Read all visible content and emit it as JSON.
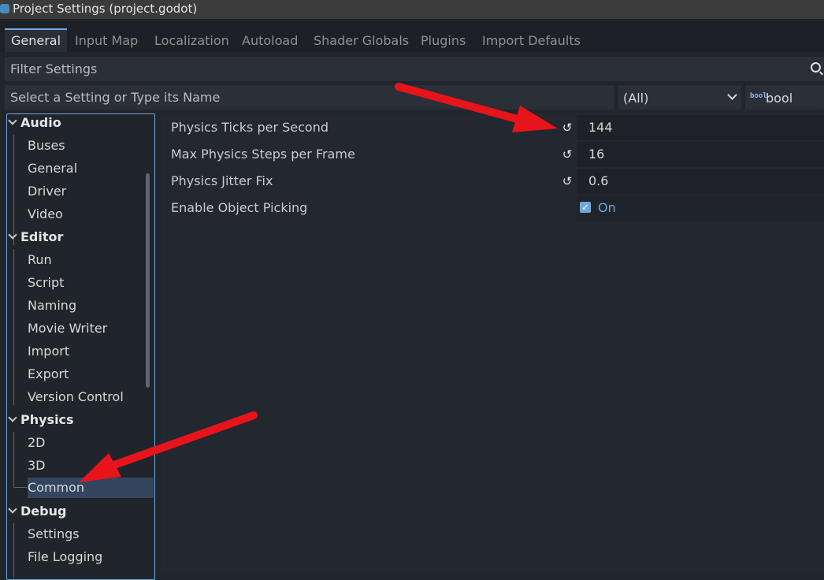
{
  "window": {
    "title": "Project Settings (project.godot)"
  },
  "tabs": [
    "General",
    "Input Map",
    "Localization",
    "Autoload",
    "Shader Globals",
    "Plugins",
    "Import Defaults"
  ],
  "filter": {
    "placeholder": "Filter Settings"
  },
  "add_setting": {
    "name_placeholder": "Select a Setting or Type its Name",
    "type_filter": "(All)",
    "type_icon": "bool",
    "type_value": "bool"
  },
  "tree": {
    "sections": [
      {
        "label": "Audio",
        "items": [
          "Buses",
          "General",
          "Driver",
          "Video"
        ]
      },
      {
        "label": "Editor",
        "items": [
          "Run",
          "Script",
          "Naming",
          "Movie Writer",
          "Import",
          "Export",
          "Version Control"
        ]
      },
      {
        "label": "Physics",
        "items": [
          "2D",
          "3D",
          "Common"
        ]
      },
      {
        "label": "Debug",
        "items": [
          "Settings",
          "File Logging"
        ]
      }
    ],
    "selected": "Common"
  },
  "properties": [
    {
      "label": "Physics Ticks per Second",
      "value": "144"
    },
    {
      "label": "Max Physics Steps per Frame",
      "value": "16"
    },
    {
      "label": "Physics Jitter Fix",
      "value": "0.6"
    },
    {
      "label": "Enable Object Picking",
      "value": "On",
      "checked": true
    }
  ],
  "colors": {
    "accent": "#6fa7dd",
    "annotation_arrow": "#e8141b",
    "background": "#21252c"
  }
}
